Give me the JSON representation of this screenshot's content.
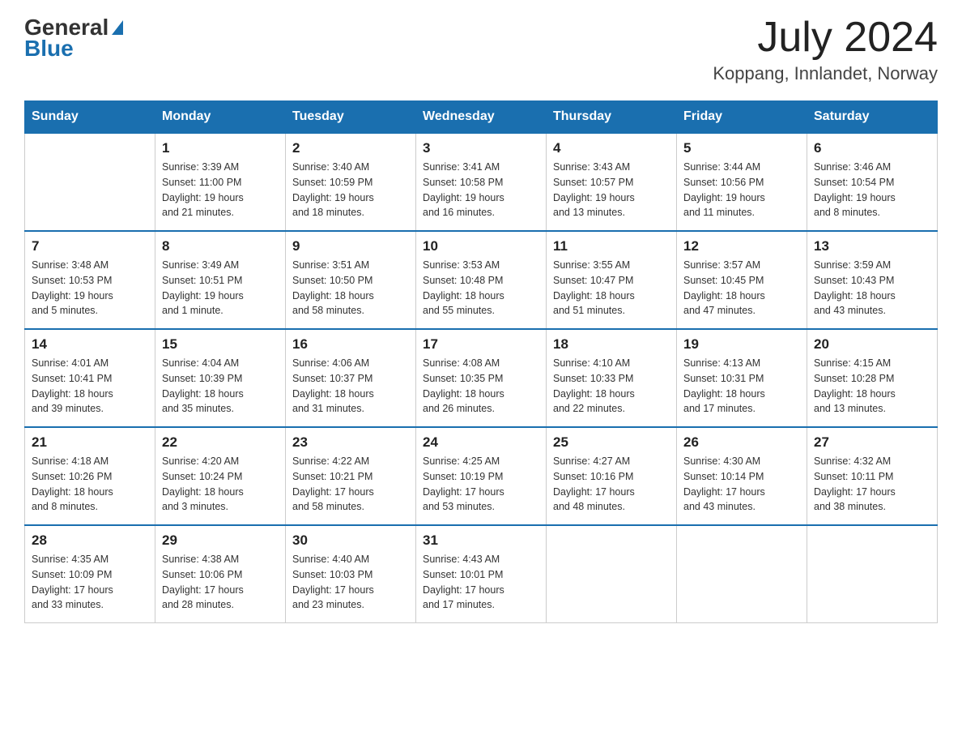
{
  "logo": {
    "general_text": "General",
    "blue_text": "Blue"
  },
  "title": {
    "month_year": "July 2024",
    "location": "Koppang, Innlandet, Norway"
  },
  "weekdays": [
    "Sunday",
    "Monday",
    "Tuesday",
    "Wednesday",
    "Thursday",
    "Friday",
    "Saturday"
  ],
  "weeks": [
    [
      {
        "day": "",
        "info": ""
      },
      {
        "day": "1",
        "info": "Sunrise: 3:39 AM\nSunset: 11:00 PM\nDaylight: 19 hours\nand 21 minutes."
      },
      {
        "day": "2",
        "info": "Sunrise: 3:40 AM\nSunset: 10:59 PM\nDaylight: 19 hours\nand 18 minutes."
      },
      {
        "day": "3",
        "info": "Sunrise: 3:41 AM\nSunset: 10:58 PM\nDaylight: 19 hours\nand 16 minutes."
      },
      {
        "day": "4",
        "info": "Sunrise: 3:43 AM\nSunset: 10:57 PM\nDaylight: 19 hours\nand 13 minutes."
      },
      {
        "day": "5",
        "info": "Sunrise: 3:44 AM\nSunset: 10:56 PM\nDaylight: 19 hours\nand 11 minutes."
      },
      {
        "day": "6",
        "info": "Sunrise: 3:46 AM\nSunset: 10:54 PM\nDaylight: 19 hours\nand 8 minutes."
      }
    ],
    [
      {
        "day": "7",
        "info": "Sunrise: 3:48 AM\nSunset: 10:53 PM\nDaylight: 19 hours\nand 5 minutes."
      },
      {
        "day": "8",
        "info": "Sunrise: 3:49 AM\nSunset: 10:51 PM\nDaylight: 19 hours\nand 1 minute."
      },
      {
        "day": "9",
        "info": "Sunrise: 3:51 AM\nSunset: 10:50 PM\nDaylight: 18 hours\nand 58 minutes."
      },
      {
        "day": "10",
        "info": "Sunrise: 3:53 AM\nSunset: 10:48 PM\nDaylight: 18 hours\nand 55 minutes."
      },
      {
        "day": "11",
        "info": "Sunrise: 3:55 AM\nSunset: 10:47 PM\nDaylight: 18 hours\nand 51 minutes."
      },
      {
        "day": "12",
        "info": "Sunrise: 3:57 AM\nSunset: 10:45 PM\nDaylight: 18 hours\nand 47 minutes."
      },
      {
        "day": "13",
        "info": "Sunrise: 3:59 AM\nSunset: 10:43 PM\nDaylight: 18 hours\nand 43 minutes."
      }
    ],
    [
      {
        "day": "14",
        "info": "Sunrise: 4:01 AM\nSunset: 10:41 PM\nDaylight: 18 hours\nand 39 minutes."
      },
      {
        "day": "15",
        "info": "Sunrise: 4:04 AM\nSunset: 10:39 PM\nDaylight: 18 hours\nand 35 minutes."
      },
      {
        "day": "16",
        "info": "Sunrise: 4:06 AM\nSunset: 10:37 PM\nDaylight: 18 hours\nand 31 minutes."
      },
      {
        "day": "17",
        "info": "Sunrise: 4:08 AM\nSunset: 10:35 PM\nDaylight: 18 hours\nand 26 minutes."
      },
      {
        "day": "18",
        "info": "Sunrise: 4:10 AM\nSunset: 10:33 PM\nDaylight: 18 hours\nand 22 minutes."
      },
      {
        "day": "19",
        "info": "Sunrise: 4:13 AM\nSunset: 10:31 PM\nDaylight: 18 hours\nand 17 minutes."
      },
      {
        "day": "20",
        "info": "Sunrise: 4:15 AM\nSunset: 10:28 PM\nDaylight: 18 hours\nand 13 minutes."
      }
    ],
    [
      {
        "day": "21",
        "info": "Sunrise: 4:18 AM\nSunset: 10:26 PM\nDaylight: 18 hours\nand 8 minutes."
      },
      {
        "day": "22",
        "info": "Sunrise: 4:20 AM\nSunset: 10:24 PM\nDaylight: 18 hours\nand 3 minutes."
      },
      {
        "day": "23",
        "info": "Sunrise: 4:22 AM\nSunset: 10:21 PM\nDaylight: 17 hours\nand 58 minutes."
      },
      {
        "day": "24",
        "info": "Sunrise: 4:25 AM\nSunset: 10:19 PM\nDaylight: 17 hours\nand 53 minutes."
      },
      {
        "day": "25",
        "info": "Sunrise: 4:27 AM\nSunset: 10:16 PM\nDaylight: 17 hours\nand 48 minutes."
      },
      {
        "day": "26",
        "info": "Sunrise: 4:30 AM\nSunset: 10:14 PM\nDaylight: 17 hours\nand 43 minutes."
      },
      {
        "day": "27",
        "info": "Sunrise: 4:32 AM\nSunset: 10:11 PM\nDaylight: 17 hours\nand 38 minutes."
      }
    ],
    [
      {
        "day": "28",
        "info": "Sunrise: 4:35 AM\nSunset: 10:09 PM\nDaylight: 17 hours\nand 33 minutes."
      },
      {
        "day": "29",
        "info": "Sunrise: 4:38 AM\nSunset: 10:06 PM\nDaylight: 17 hours\nand 28 minutes."
      },
      {
        "day": "30",
        "info": "Sunrise: 4:40 AM\nSunset: 10:03 PM\nDaylight: 17 hours\nand 23 minutes."
      },
      {
        "day": "31",
        "info": "Sunrise: 4:43 AM\nSunset: 10:01 PM\nDaylight: 17 hours\nand 17 minutes."
      },
      {
        "day": "",
        "info": ""
      },
      {
        "day": "",
        "info": ""
      },
      {
        "day": "",
        "info": ""
      }
    ]
  ]
}
